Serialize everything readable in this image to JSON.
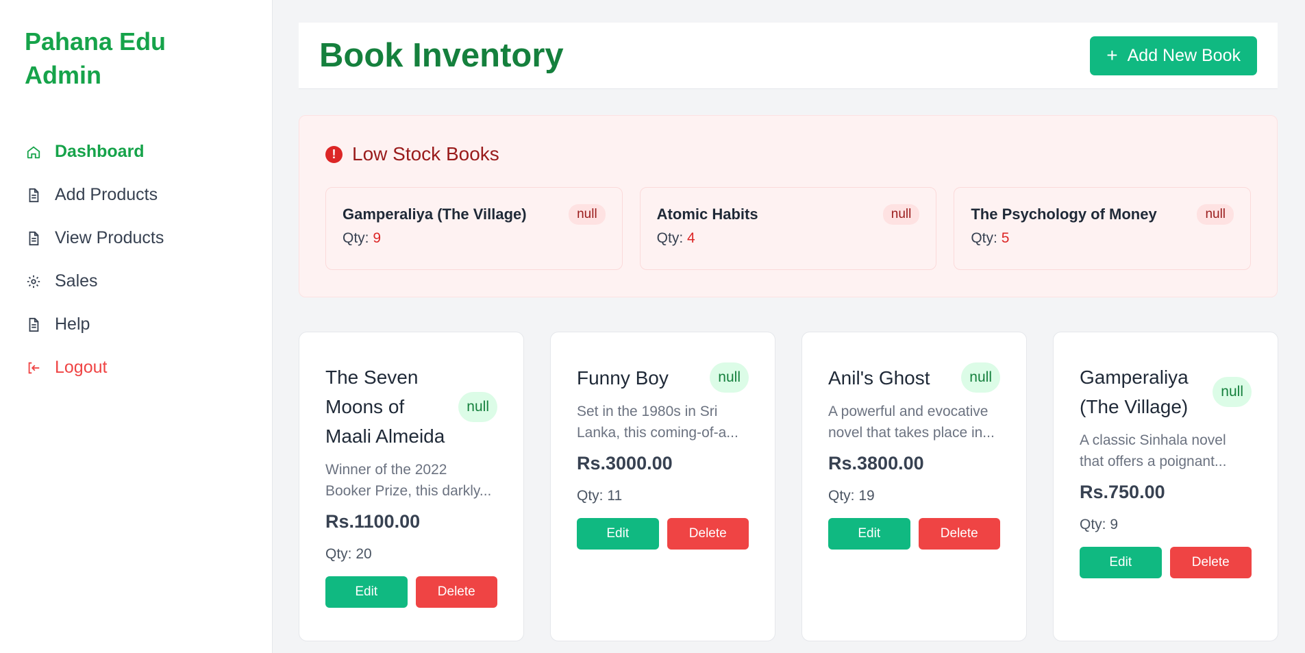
{
  "sidebar": {
    "brand": "Pahana Edu Admin",
    "items": [
      {
        "label": "Dashboard",
        "icon": "home-icon"
      },
      {
        "label": "Add Products",
        "icon": "document-icon"
      },
      {
        "label": "View Products",
        "icon": "document-icon"
      },
      {
        "label": "Sales",
        "icon": "gear-icon"
      },
      {
        "label": "Help",
        "icon": "document-icon"
      },
      {
        "label": "Logout",
        "icon": "logout-icon"
      }
    ]
  },
  "header": {
    "title": "Book Inventory",
    "add_button": "Add New Book",
    "add_icon": "+"
  },
  "low_stock": {
    "title": "Low Stock Books",
    "qty_label": "Qty:",
    "items": [
      {
        "name": "Gamperaliya (The Village)",
        "badge": "null",
        "qty": "9"
      },
      {
        "name": "Atomic Habits",
        "badge": "null",
        "qty": "4"
      },
      {
        "name": "The Psychology of Money",
        "badge": "null",
        "qty": "5"
      }
    ]
  },
  "products": [
    {
      "title": "The Seven Moons of Maali Almeida",
      "badge": "null",
      "desc1": "Winner of the 2022",
      "desc2": "Booker Prize, this darkly...",
      "price": "Rs.1100.00",
      "qty": "Qty: 20",
      "edit": "Edit",
      "delete": "Delete"
    },
    {
      "title": "Funny Boy",
      "badge": "null",
      "desc1": "Set in the 1980s in Sri",
      "desc2": "Lanka, this coming-of-a...",
      "price": "Rs.3000.00",
      "qty": "Qty: 11",
      "edit": "Edit",
      "delete": "Delete"
    },
    {
      "title": "Anil's Ghost",
      "badge": "null",
      "desc1": "A powerful and evocative",
      "desc2": "novel that takes place in...",
      "price": "Rs.3800.00",
      "qty": "Qty: 19",
      "edit": "Edit",
      "delete": "Delete"
    },
    {
      "title": "Gamperaliya (The Village)",
      "badge": "null",
      "desc1": "A classic Sinhala novel",
      "desc2": "that offers a poignant...",
      "price": "Rs.750.00",
      "qty": "Qty: 9",
      "edit": "Edit",
      "delete": "Delete"
    }
  ],
  "colors": {
    "primary": "#16a34a",
    "button_green": "#10b981",
    "button_red": "#ef4444",
    "alert_bg": "#fef2f2"
  }
}
